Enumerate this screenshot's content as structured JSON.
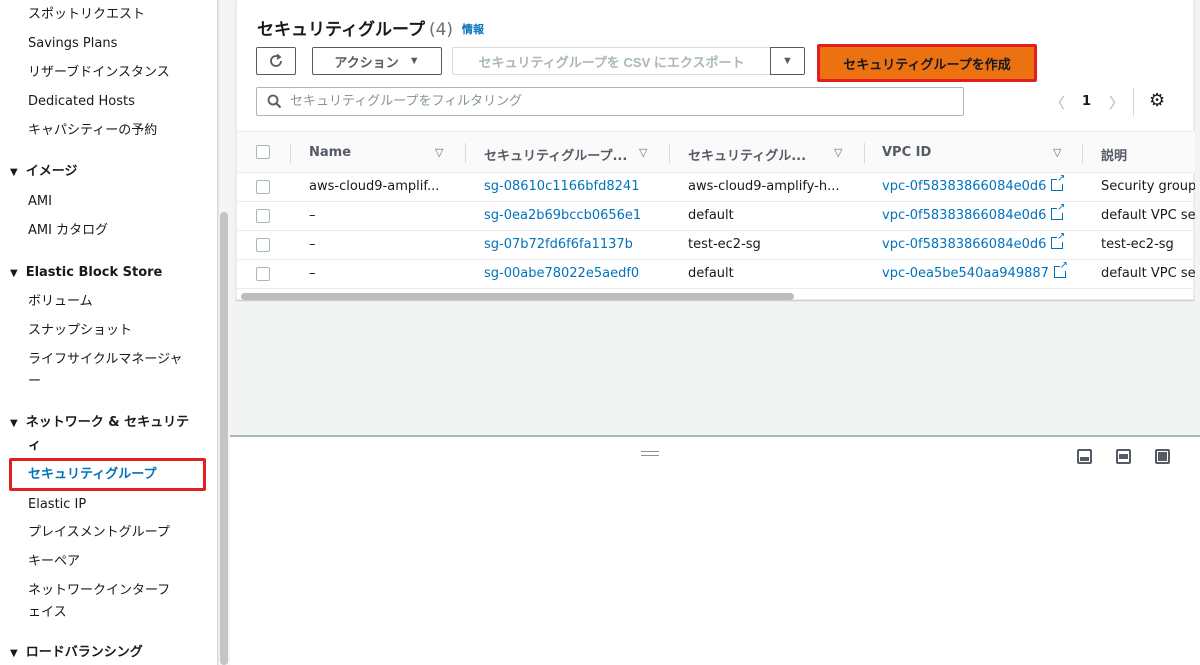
{
  "sidebar": {
    "items": [
      {
        "id": "spot",
        "label": "スポットリクエスト"
      },
      {
        "id": "savings",
        "label": "Savings Plans"
      },
      {
        "id": "reserved",
        "label": "リザーブドインスタンス"
      },
      {
        "id": "dedicated",
        "label": "Dedicated Hosts"
      },
      {
        "id": "capacity",
        "label": "キャパシティーの予約"
      }
    ],
    "image_section": {
      "label": "イメージ",
      "items": [
        "AMI",
        "AMI カタログ"
      ]
    },
    "ebs_section": {
      "label": "Elastic Block Store",
      "items": [
        "ボリューム",
        "スナップショット",
        "ライフサイクルマネージャー"
      ]
    },
    "network_section": {
      "label": "ネットワーク & セキュリティ",
      "items": [
        "セキュリティグループ",
        "Elastic IP",
        "プレイスメントグループ",
        "キーペア",
        "ネットワークインターフェイス"
      ]
    },
    "lb_section": {
      "label": "ロードバランシング"
    }
  },
  "header": {
    "title": "セキュリティグループ",
    "count": "(4)",
    "info": "情報"
  },
  "toolbar": {
    "action_label": "アクション",
    "export_label": "セキュリティグループを CSV にエクスポート",
    "create_label": "セキュリティグループを作成"
  },
  "filter": {
    "placeholder": "セキュリティグループをフィルタリング"
  },
  "pagination": {
    "current": "1"
  },
  "table": {
    "columns": [
      "Name",
      "セキュリティグループ...",
      "セキュリティグル...",
      "VPC ID",
      "説明"
    ],
    "rows": [
      {
        "name": "aws-cloud9-amplif...",
        "sg_id": "sg-08610c1166bfd8241",
        "sg_name": "aws-cloud9-amplify-h...",
        "vpc": "vpc-0f58383866084e0d6",
        "desc": "Security group"
      },
      {
        "name": "–",
        "sg_id": "sg-0ea2b69bccb0656e1",
        "sg_name": "default",
        "vpc": "vpc-0f58383866084e0d6",
        "desc": "default VPC se"
      },
      {
        "name": "–",
        "sg_id": "sg-07b72fd6f6fa1137b",
        "sg_name": "test-ec2-sg",
        "vpc": "vpc-0f58383866084e0d6",
        "desc": "test-ec2-sg"
      },
      {
        "name": "–",
        "sg_id": "sg-00abe78022e5aedf0",
        "sg_name": "default",
        "vpc": "vpc-0ea5be540aa949887",
        "desc": "default VPC se"
      }
    ]
  },
  "colors": {
    "accent": "#0073bb",
    "primary_button": "#ec7211",
    "highlight": "#e02020"
  }
}
